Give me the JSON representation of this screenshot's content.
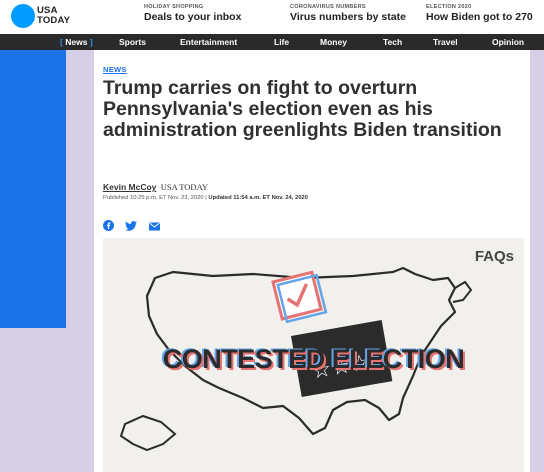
{
  "brand": {
    "line1": "USA",
    "line2": "TODAY",
    "color": "#009bff"
  },
  "promos": [
    {
      "kicker": "HOLIDAY SHOPPING",
      "headline": "Deals to your inbox"
    },
    {
      "kicker": "CORONAVIRUS NUMBERS",
      "headline": "Virus numbers by state"
    },
    {
      "kicker": "ELECTION 2020",
      "headline": "How Biden got to 270"
    }
  ],
  "nav": {
    "items": [
      "News",
      "Sports",
      "Entertainment",
      "Life",
      "Money",
      "Tech",
      "Travel",
      "Opinion"
    ],
    "active": "News",
    "bracket_open": "[",
    "bracket_close": "]"
  },
  "article": {
    "section": "NEWS",
    "title": "Trump carries on fight to overturn Pennsylvania's election even as his administration greenlights Biden transition",
    "author": "Kevin McCoy",
    "organization": "USA TODAY",
    "published": "Published 10:25 p.m. ET Nov. 23, 2020",
    "separator": "|",
    "updated": "Updated 11:54 a.m. ET Nov. 24, 2020",
    "share_icons": [
      "facebook-icon",
      "twitter-icon",
      "email-icon"
    ]
  },
  "hero": {
    "badge": "FAQs",
    "caption_art": "CONTESTED ELECTION"
  },
  "colors": {
    "accent": "#1a73e8",
    "nav_bg": "#2a2a2a",
    "page_bg": "#d7cfe6"
  }
}
